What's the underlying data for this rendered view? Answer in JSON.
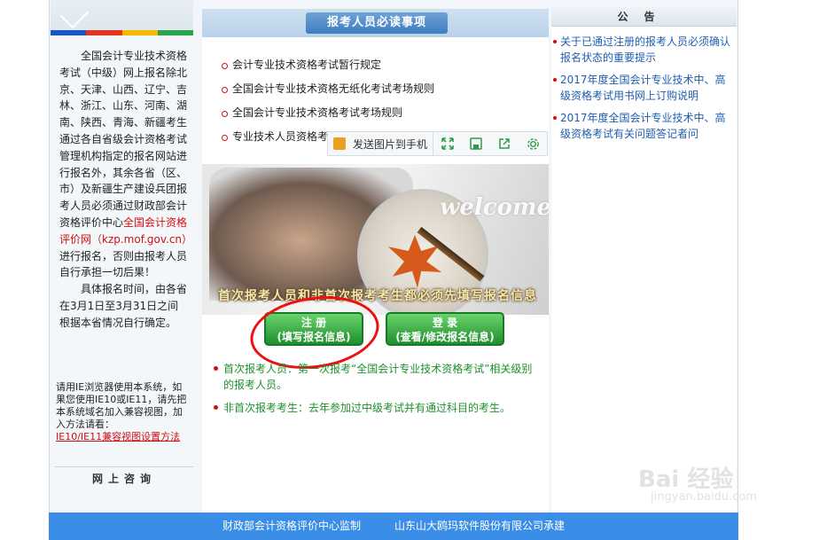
{
  "left": {
    "paragraphs": [
      "全国会计专业技术资格考试（中级）网上报名除北京、天津、山西、辽宁、吉林、浙江、山东、河南、湖南、陕西、青海、新疆考生通过各自省级会计资格考试管理机构指定的报名网站进行报名外，其余各省（区、市）及新疆生产建设兵团报考人员必须通过财政部会计资格评价中心",
      "全国会计资格评价网（kzp.mof.gov.cn）",
      "进行报名，否则由报考人员自行承担一切后果！",
      "具体报名时间，由各省在3月1日至3月31日之间根据本省情况自行确定。"
    ],
    "note": "请用IE浏览器使用本系统，如果您使用IE10或IE11，请先把本系统域名加入兼容视图，加入方法请看：",
    "note_link": "IE10/IE11兼容视图设置方法",
    "consult_title": "网上咨询",
    "colors": [
      "#1a56c4",
      "#e0381e",
      "#f5b800",
      "#2aa34a"
    ]
  },
  "center": {
    "header": "报考人员必读事项",
    "notices": [
      "会计专业技术资格考试暂行规定",
      "全国会计专业技术资格无纸化考试考场规则",
      "全国会计专业技术资格考试考场规则",
      "专业技术人员资格考"
    ],
    "toolbar": {
      "send_label": "发送图片到手机",
      "icons": [
        "expand-icon",
        "save-icon",
        "share-icon",
        "settings-icon"
      ]
    },
    "welcome_text": "welcome",
    "banner": "首次报考人员和非首次报考考生都必须先填写报名信息",
    "register_button": {
      "line1": "注 册",
      "line2": "(填写报名信息)"
    },
    "login_button": {
      "line1": "登 录",
      "line2": "(查看/修改报名信息)"
    },
    "explain": [
      "首次报考人员：第一次报考“全国会计专业技术资格考试”相关级别的报考人员。",
      "非首次报考考生：去年参加过中级考试并有通过科目的考生。"
    ]
  },
  "right": {
    "header": "公告",
    "announcements": [
      "关于已通过注册的报考人员必须确认报名状态的重要提示",
      "2017年度全国会计专业技术中、高级资格考试用书网上订购说明",
      "2017年度全国会计专业技术中、高级资格考试有关问题答记者问"
    ]
  },
  "footer": {
    "left": "财政部会计资格评价中心监制",
    "right": "山东山大鸥玛软件股份有限公司承建"
  },
  "watermark": {
    "main": "Bai 经验",
    "sub": "jingyan.baidu.com"
  }
}
